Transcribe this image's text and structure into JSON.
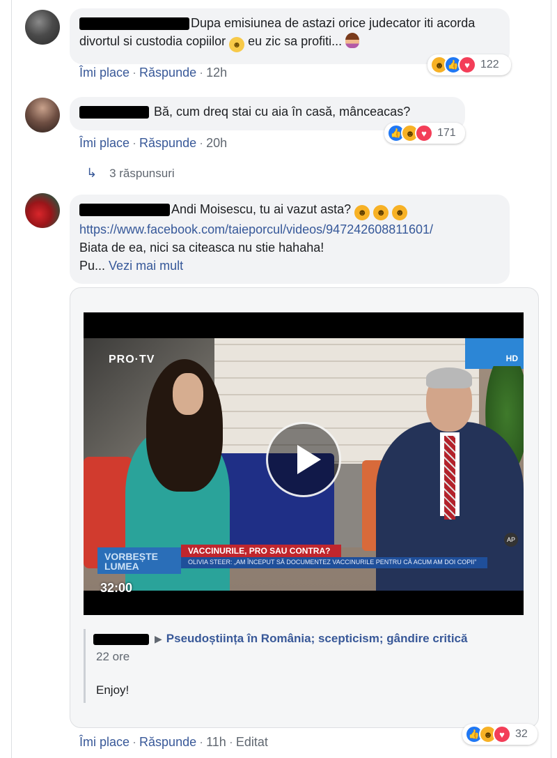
{
  "comments": [
    {
      "text": "Dupa emisiunea de astazi orice judecator iti acorda divortul si custodia copiilor",
      "text_end": "eu zic sa profiti...",
      "emoji_1": "face-with-open-mouth",
      "emoji_2": "woman-shrugging",
      "actions": {
        "like": "Îmi place",
        "reply": "Răspunde",
        "time": "12h"
      },
      "reactions": {
        "types": [
          "haha",
          "like",
          "love"
        ],
        "count": "122"
      }
    },
    {
      "text": "Bă, cum dreq stai cu aia în casă, mânceacas?",
      "actions": {
        "like": "Îmi place",
        "reply": "Răspunde",
        "time": "20h"
      },
      "reactions": {
        "types": [
          "like",
          "haha",
          "love"
        ],
        "count": "171"
      },
      "replies_label": "3 răspunsuri"
    },
    {
      "text": "Andi Moisescu, tu ai vazut asta?",
      "emojis": [
        "haha",
        "haha",
        "haha"
      ],
      "link": "https://www.facebook.com/taieporcul/videos/947242608811601/",
      "line3": "Biata de ea, nici sa citeasca nu stie hahaha!",
      "line4": "Pu...",
      "see_more": "Vezi mai mult",
      "actions": {
        "like": "Îmi place",
        "reply": "Răspunde",
        "time": "11h",
        "edited": "Editat"
      },
      "reactions": {
        "types": [
          "like",
          "haha",
          "love"
        ],
        "count": "32"
      }
    }
  ],
  "video": {
    "channel_logo": "PRO·TV",
    "hd_badge": "HD",
    "show_name": "VORBEȘTE LUMEA",
    "headline": "VACCINURILE, PRO SAU CONTRA?",
    "subheadline": "OLIVIA STEER: „AM ÎNCEPUT SĂ DOCUMENTEZ VACCINURILE PENTRU CĂ ACUM AM DOI COPII”",
    "ap_badge": "AP",
    "duration": "32:00"
  },
  "shared": {
    "group": "Pseudoștiința în România; scepticism; gândire critică",
    "time": "22 ore",
    "message": "Enjoy!"
  },
  "icons": {
    "reply_arrow": "reply-arrow-icon",
    "play": "play-icon",
    "caret": "caret-right-icon"
  },
  "colors": {
    "link": "#365899",
    "bubble": "#f2f3f5",
    "like": "#2078f4",
    "love": "#f33e58",
    "haha": "#f7b125"
  }
}
